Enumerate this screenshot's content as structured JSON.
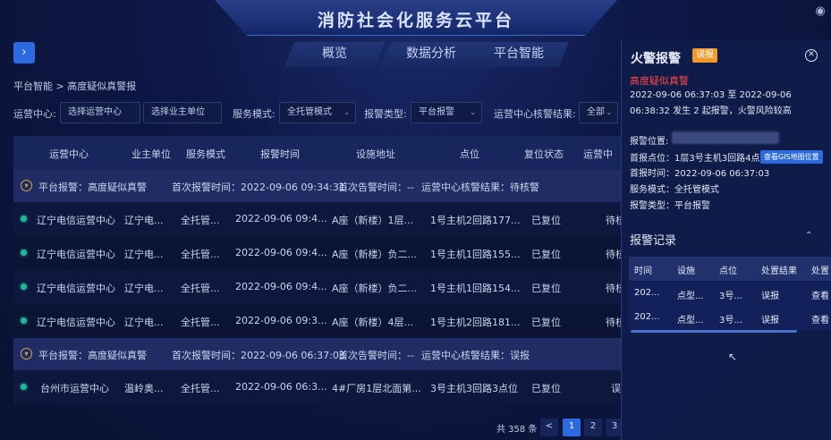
{
  "header": {
    "title": "消防社会化服务云平台",
    "globe_icon": "globe-icon"
  },
  "nav": {
    "tabs": [
      "概览",
      "数据分析",
      "平台智能"
    ]
  },
  "breadcrumb": "平台智能 > 高度疑似真警报",
  "filters": {
    "center_label": "运营中心:",
    "center_placeholder": "选择运营中心",
    "owner_placeholder": "选择业主单位",
    "mode_label": "服务模式:",
    "mode_value": "全托管模式",
    "type_label": "报警类型:",
    "type_value": "平台报警",
    "verify_label": "运营中心核警结果:",
    "verify_value": "全部"
  },
  "table": {
    "headers": [
      "运营中心",
      "业主单位",
      "服务模式",
      "报警时间",
      "设施地址",
      "点位",
      "复位状态",
      "运营中"
    ],
    "groups": [
      {
        "title": "平台报警：高度疑似真警",
        "first_alarm": "首次报警时间：2022-09-06 09:34:31",
        "first_report": "首次告警时间：--",
        "verify": "运营中心核警结果：待核警",
        "rows": [
          [
            "辽宁电信运营中心",
            "辽宁电...",
            "全托管...",
            "2022-09-06 09:4...",
            "A座（新楼）1层...",
            "1号主机2回路177...",
            "已复位",
            "待核"
          ],
          [
            "辽宁电信运营中心",
            "辽宁电...",
            "全托管...",
            "2022-09-06 09:4...",
            "A座（新楼）负二...",
            "1号主机1回路155...",
            "已复位",
            "待核"
          ],
          [
            "辽宁电信运营中心",
            "辽宁电...",
            "全托管...",
            "2022-09-06 09:4...",
            "A座（新楼）负二...",
            "1号主机1回路154...",
            "已复位",
            "待核"
          ],
          [
            "辽宁电信运营中心",
            "辽宁电...",
            "全托管...",
            "2022-09-06 09:3...",
            "A座（新楼）4层...",
            "1号主机2回路181...",
            "已复位",
            "待核"
          ]
        ]
      },
      {
        "title": "平台报警：高度疑似真警",
        "first_alarm": "首次报警时间：2022-09-06 06:37:03",
        "first_report": "首次告警时间：--",
        "verify": "运营中心核警结果：误报",
        "rows": [
          [
            "台州市运营中心",
            "温岭奥...",
            "全托管...",
            "2022-09-06 06:3...",
            "4#厂房1层北面第...",
            "3号主机3回路3点位",
            "已复位",
            "误报"
          ]
        ]
      }
    ]
  },
  "pager": {
    "total": "共 358 条",
    "prev": "<",
    "pages": [
      "1",
      "2",
      "3"
    ]
  },
  "panel": {
    "title": "火警报警",
    "badge": "误报",
    "level": "高度疑似真警",
    "desc": "2022-09-06 06:37:03 至 2022-09-06 06:38:32 发生 2 起报警，火警风险较高",
    "location_label": "报警位置:",
    "first_point": "首报点位：1层3号主机3回路4点位",
    "gis_button": "查看GIS地图位置",
    "first_time": "首报时间：2022-09-06 06:37:03",
    "mode": "服务模式：全托管模式",
    "type": "报警类型：平台报警",
    "records_title": "报警记录",
    "records": {
      "headers": [
        "时间",
        "设施",
        "点位",
        "处置结果",
        "处置"
      ],
      "rows": [
        [
          "202...",
          "点型...",
          "3号...",
          "误报",
          "查看"
        ],
        [
          "202...",
          "点型...",
          "3号...",
          "误报",
          "查看"
        ]
      ]
    }
  }
}
